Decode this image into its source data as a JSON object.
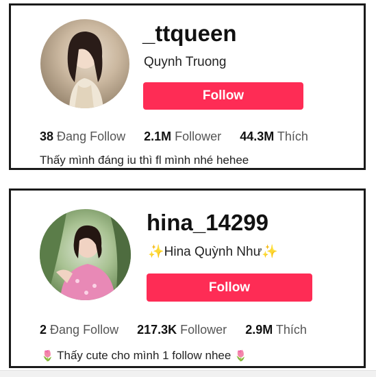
{
  "profiles": [
    {
      "username": "_ttqueen",
      "display_name": "Quynh Truong",
      "follow_label": "Follow",
      "following_count": "38",
      "following_label": "Đang Follow",
      "followers_count": "2.1M",
      "followers_label": "Follower",
      "likes_count": "44.3M",
      "likes_label": "Thích",
      "bio": "Thấy mình đáng iu thì fl mình nhé hehee"
    },
    {
      "username": "hina_14299",
      "display_name_prefix": "✨",
      "display_name": "Hina Quỳnh Như",
      "display_name_suffix": "✨",
      "follow_label": "Follow",
      "following_count": "2",
      "following_label": "Đang Follow",
      "followers_count": "217.3K",
      "followers_label": "Follower",
      "likes_count": "2.9M",
      "likes_label": "Thích",
      "bio_prefix": "🌷",
      "bio": "Thấy cute cho mình 1 follow nhee",
      "bio_suffix": "🌷"
    }
  ],
  "colors": {
    "follow_button": "#fe2c55",
    "card_border": "#1a1a1a"
  },
  "icons": [
    "sparkle-icon",
    "tulip-icon"
  ]
}
